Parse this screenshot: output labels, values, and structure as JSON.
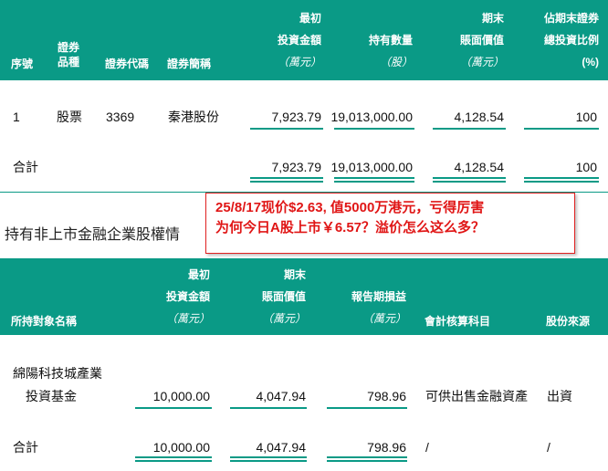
{
  "table1": {
    "headers": {
      "seq": "序號",
      "type_l1": "證券",
      "type_l2": "品種",
      "code": "證券代碼",
      "name": "證券簡稱",
      "cost_l1": "最初",
      "cost_l2": "投資金額",
      "cost_unit": "（萬元）",
      "qty_l1": "持有數量",
      "qty_unit": "（股）",
      "book_l1": "期末",
      "book_l2": "賬面價值",
      "book_unit": "（萬元）",
      "ratio_l1": "佔期末證券",
      "ratio_l2": "總投資比例",
      "ratio_unit": "(%)"
    },
    "row": {
      "seq": "1",
      "type": "股票",
      "code": "3369",
      "name": "秦港股份",
      "cost": "7,923.79",
      "qty": "19,013,000.00",
      "book": "4,128.54",
      "ratio": "100"
    },
    "total": {
      "label": "合計",
      "cost": "7,923.79",
      "qty": "19,013,000.00",
      "book": "4,128.54",
      "ratio": "100"
    }
  },
  "section2": {
    "title": "持有非上市金融企業股權情"
  },
  "note": {
    "line1": "25/8/17现价$2.63, 值5000万港元，亏得厉害",
    "line2": "为何今日A股上市￥6.57？溢价怎么这么多？"
  },
  "table2": {
    "headers": {
      "name": "所持對象名稱",
      "cost_l1": "最初",
      "cost_l2": "投資金額",
      "cost_unit": "（萬元）",
      "book_l1": "期末",
      "book_l2": "賬面價值",
      "book_unit": "（萬元）",
      "pl_l1": "報告期損益",
      "pl_unit": "（萬元）",
      "acct": "會計核算科目",
      "source": "股份來源"
    },
    "row": {
      "name_l1": "綿陽科技城產業",
      "name_l2": "投資基金",
      "cost": "10,000.00",
      "book": "4,047.94",
      "pl": "798.96",
      "acct": "可供出售金融資產",
      "source": "出資"
    },
    "total": {
      "label": "合計",
      "cost": "10,000.00",
      "book": "4,047.94",
      "pl": "798.96",
      "acct": "/",
      "source": "/"
    }
  }
}
